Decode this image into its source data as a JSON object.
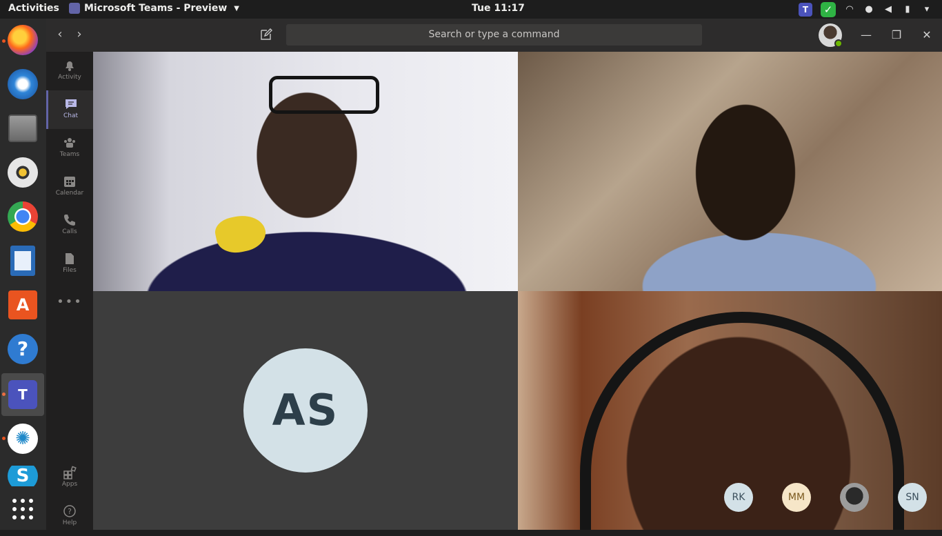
{
  "system": {
    "activities_label": "Activities",
    "app_menu_label": "Microsoft Teams - Preview",
    "clock": "Tue 11:17",
    "tray_icons": [
      "teams-icon",
      "check-icon",
      "wifi-icon",
      "notification-icon",
      "volume-icon",
      "battery-icon",
      "power-menu-icon"
    ]
  },
  "dock": {
    "items": [
      {
        "name": "Firefox",
        "icon": "firefox-icon",
        "running": true
      },
      {
        "name": "Thunderbird",
        "icon": "thunderbird-icon",
        "running": false
      },
      {
        "name": "Files",
        "icon": "files-icon",
        "running": false
      },
      {
        "name": "Rhythmbox",
        "icon": "rhythmbox-icon",
        "running": false
      },
      {
        "name": "Chrome",
        "icon": "chrome-icon",
        "running": false
      },
      {
        "name": "LibreOffice Writer",
        "icon": "writer-icon",
        "running": false
      },
      {
        "name": "Ubuntu Software",
        "icon": "software-icon",
        "running": false
      },
      {
        "name": "Help",
        "icon": "help-icon",
        "running": false
      },
      {
        "name": "Microsoft Teams - Preview",
        "icon": "teams-icon",
        "running": true,
        "active": true
      },
      {
        "name": "Coral",
        "icon": "coral-icon",
        "running": true
      },
      {
        "name": "Skype",
        "icon": "skype-icon",
        "running": false
      }
    ],
    "show_apps": "show-applications-icon"
  },
  "header": {
    "search_placeholder": "Search or type a command"
  },
  "appbar": {
    "items": [
      {
        "label": "Activity",
        "icon": "bell-icon"
      },
      {
        "label": "Chat",
        "icon": "chat-icon",
        "active": true
      },
      {
        "label": "Teams",
        "icon": "teams-people-icon"
      },
      {
        "label": "Calendar",
        "icon": "calendar-icon"
      },
      {
        "label": "Calls",
        "icon": "phone-icon"
      },
      {
        "label": "Files",
        "icon": "file-icon"
      }
    ],
    "more": "•••",
    "bottom": [
      {
        "label": "Apps",
        "icon": "apps-icon"
      },
      {
        "label": "Help",
        "icon": "help-icon"
      }
    ]
  },
  "call": {
    "tiles": [
      {
        "kind": "video",
        "name": "participant-video-1"
      },
      {
        "kind": "video",
        "name": "participant-video-2"
      },
      {
        "kind": "avatar",
        "initials": "AS"
      },
      {
        "kind": "video",
        "name": "participant-video-4"
      }
    ],
    "overflow_participants": [
      "RK",
      "MM",
      "",
      "SN"
    ]
  },
  "colors": {
    "teams_purple": "#6264a7",
    "presence_available": "#6bb700",
    "avatar_bg": "#d3e1e7"
  }
}
